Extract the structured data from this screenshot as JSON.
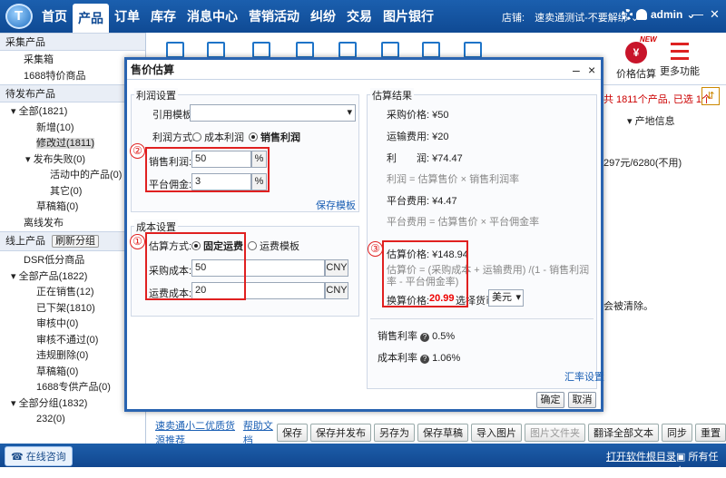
{
  "app": {
    "nav": [
      "首页",
      "产品",
      "订单",
      "库存",
      "消息中心",
      "营销活动",
      "纠纷",
      "交易",
      "图片银行"
    ],
    "active_nav": "产品",
    "store_label": "店铺:",
    "store_name": "速卖通测试-不要解绑",
    "user": "admin",
    "minimize": "—",
    "close": "✕"
  },
  "sidebar": {
    "sec1": "采集产品",
    "collect": [
      "采集箱",
      "1688特价商品"
    ],
    "sec2": "待发布产品",
    "pending_all": "全部(1821)",
    "new": "新增(10)",
    "modified": "修改过(1811)",
    "publish_failed": "发布失败(0)",
    "in_activity": "活动中的产品(0)",
    "other": "其它(0)",
    "drafts": "草稿箱(0)",
    "offline_publish": "离线发布",
    "sec3": "线上产品",
    "refresh_group": "刷新分组",
    "online": [
      "DSR低分商品"
    ],
    "all_products": "全部产品(1822)",
    "status": [
      "正在销售(12)",
      "已下架(1810)",
      "审核中(0)",
      "审核不通过(0)",
      "违规删除(0)",
      "草稿箱(0)",
      "1688专供产品(0)"
    ],
    "all_groups": "全部分组(1832)",
    "group1": "232(0)"
  },
  "main": {
    "price_estimate": "价格估算",
    "more_functions": "更多功能",
    "new_badge": "NEW",
    "count_text_prefix": "共 1811个产品, 已选 1个",
    "origin_info": "产地信息",
    "behind_text1": "297元/6280(不用)",
    "behind_text2": "会被清除。"
  },
  "bottom": {
    "links": [
      "速卖通小二优质货源推荐",
      "帮助文档"
    ],
    "buttons": [
      "保存",
      "保存并发布",
      "另存为",
      "保存草稿",
      "导入图片",
      "图片文件夹",
      "翻译全部文本",
      "同步",
      "重置"
    ]
  },
  "statusbar": {
    "online_consult": "在线咨询",
    "open_log": "打开软件根目录",
    "all_tasks": "所有任务"
  },
  "dialog": {
    "title": "售价估算",
    "profit_section": "利润设置",
    "ref_template": "引用模板:",
    "profit_method": "利润方式:",
    "cost_profit": "成本利润",
    "sales_profit": "销售利润",
    "sales_margin_label": "销售利润:",
    "sales_margin_value": "50",
    "platform_fee_label": "平台佣金:",
    "platform_fee_value": "3",
    "percent": "%",
    "save_template": "保存模板",
    "cost_section": "成本设置",
    "estimate_method": "估算方式:",
    "fixed_freight": "固定运费",
    "freight_template": "运费模板",
    "purchase_cost_label": "采购成本:",
    "purchase_cost_value": "50",
    "freight_cost_label": "运费成本:",
    "freight_cost_value": "20",
    "currency": "CNY",
    "result_section": "估算结果",
    "purchase_price": "采购价格: ¥50",
    "shipping_fee": "运输费用: ¥20",
    "profit": "利　　润: ¥74.47",
    "profit_formula": "利润 = 估算售价 × 销售利润率",
    "platform_fee": "平台费用: ¥4.47",
    "platform_formula": "平台费用 = 估算售价 × 平台佣金率",
    "estimated_price": "估算价格: ¥148.94",
    "price_formula": "估算价 = (采购成本 + 运输费用) /(1 - 销售利润率 - 平台佣金率)",
    "converted_label": "换算价格:",
    "converted_value": "20.99",
    "select_currency": "选择货币",
    "currency_choice": "美元",
    "sales_rate": "销售利率",
    "sales_rate_value": "0.5%",
    "cost_rate": "成本利率",
    "cost_rate_value": "1.06%",
    "rate_settings": "汇率设置",
    "ok": "确定",
    "cancel": "取消",
    "markers": [
      "①",
      "②",
      "③"
    ]
  }
}
